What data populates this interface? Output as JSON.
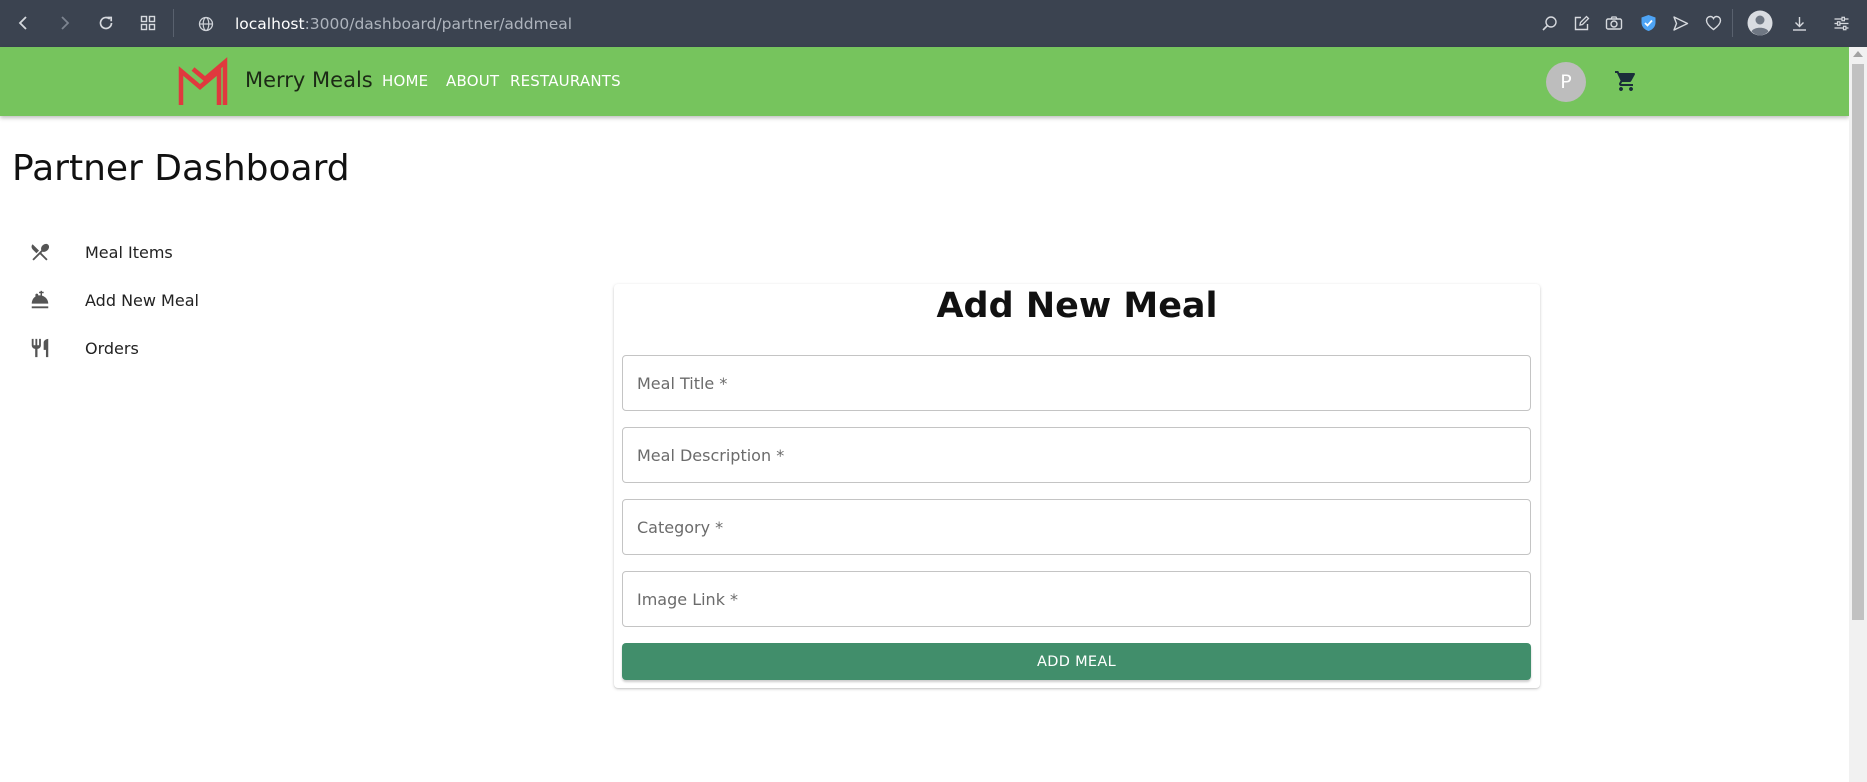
{
  "browser": {
    "url_host": "localhost",
    "url_path": ":3000/dashboard/partner/addmeal"
  },
  "header": {
    "brand": "Merry Meals",
    "nav": [
      {
        "label": "HOME"
      },
      {
        "label": "ABOUT"
      },
      {
        "label": "RESTAURANTS"
      }
    ],
    "avatar_initial": "P",
    "colors": {
      "bar": "#76c45d",
      "logo": "#e0393e"
    }
  },
  "page": {
    "title": "Partner Dashboard"
  },
  "sidebar": {
    "items": [
      {
        "label": "Meal Items",
        "icon": "restaurant-crossed-icon"
      },
      {
        "label": "Add New Meal",
        "icon": "room-service-icon"
      },
      {
        "label": "Orders",
        "icon": "cutlery-icon"
      }
    ]
  },
  "form": {
    "title": "Add New Meal",
    "fields": [
      {
        "placeholder": "Meal Title *",
        "value": ""
      },
      {
        "placeholder": "Meal Description *",
        "value": ""
      },
      {
        "placeholder": "Category *",
        "value": ""
      },
      {
        "placeholder": "Image Link *",
        "value": ""
      }
    ],
    "submit_label": "ADD MEAL",
    "submit_color": "#418e6b"
  }
}
